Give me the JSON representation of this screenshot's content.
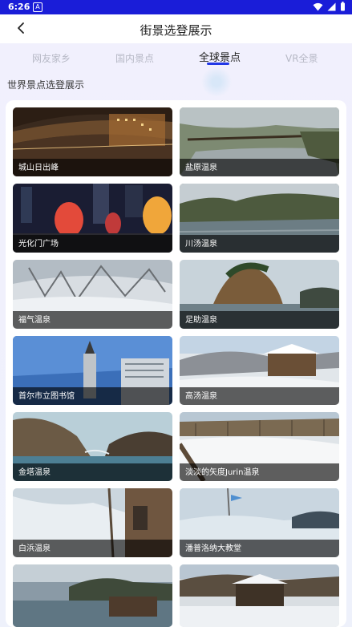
{
  "status_bar": {
    "time": "6:26",
    "app_icon_letter": "A"
  },
  "header": {
    "title": "街景选登展示"
  },
  "tabs": [
    {
      "label": "网友家乡",
      "active": false
    },
    {
      "label": "国内景点",
      "active": false
    },
    {
      "label": "全球景点",
      "active": true
    },
    {
      "label": "VR全景",
      "active": false
    }
  ],
  "section": {
    "title": "世界景点选登展示"
  },
  "spots": [
    {
      "name": "城山日出峰"
    },
    {
      "name": "盐原温泉"
    },
    {
      "name": "光化门广场"
    },
    {
      "name": "川汤温泉"
    },
    {
      "name": "福气温泉"
    },
    {
      "name": "足助温泉"
    },
    {
      "name": "首尔市立图书馆"
    },
    {
      "name": "高汤温泉"
    },
    {
      "name": "金塔温泉"
    },
    {
      "name": "淡淡的矢度Jurin温泉"
    },
    {
      "name": "白浜温泉"
    },
    {
      "name": "潘普洛纳大教堂"
    },
    {
      "name": ""
    },
    {
      "name": ""
    }
  ],
  "colors": {
    "accent": "#2238e6",
    "status_bar": "#1a1dd8"
  }
}
